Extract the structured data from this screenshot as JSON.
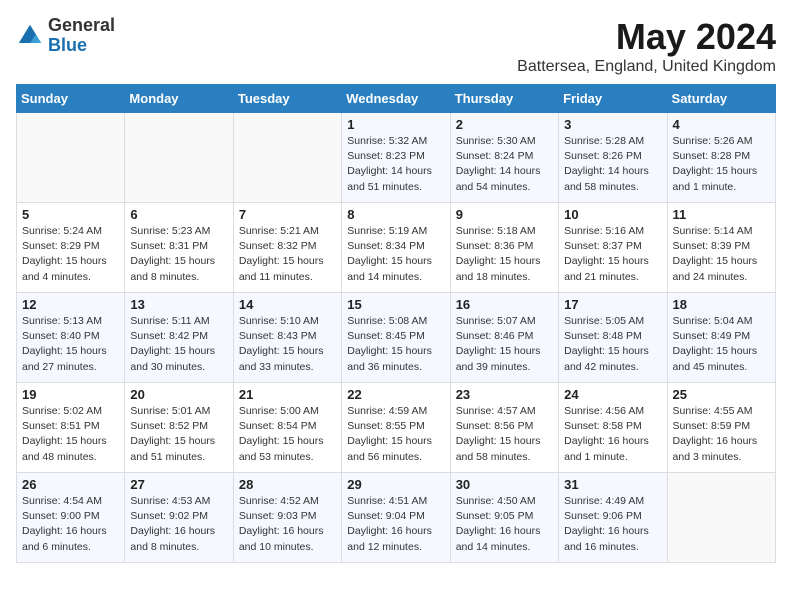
{
  "logo": {
    "general": "General",
    "blue": "Blue"
  },
  "title": "May 2024",
  "subtitle": "Battersea, England, United Kingdom",
  "days_header": [
    "Sunday",
    "Monday",
    "Tuesday",
    "Wednesday",
    "Thursday",
    "Friday",
    "Saturday"
  ],
  "weeks": [
    [
      {
        "day": "",
        "detail": ""
      },
      {
        "day": "",
        "detail": ""
      },
      {
        "day": "",
        "detail": ""
      },
      {
        "day": "1",
        "detail": "Sunrise: 5:32 AM\nSunset: 8:23 PM\nDaylight: 14 hours\nand 51 minutes."
      },
      {
        "day": "2",
        "detail": "Sunrise: 5:30 AM\nSunset: 8:24 PM\nDaylight: 14 hours\nand 54 minutes."
      },
      {
        "day": "3",
        "detail": "Sunrise: 5:28 AM\nSunset: 8:26 PM\nDaylight: 14 hours\nand 58 minutes."
      },
      {
        "day": "4",
        "detail": "Sunrise: 5:26 AM\nSunset: 8:28 PM\nDaylight: 15 hours\nand 1 minute."
      }
    ],
    [
      {
        "day": "5",
        "detail": "Sunrise: 5:24 AM\nSunset: 8:29 PM\nDaylight: 15 hours\nand 4 minutes."
      },
      {
        "day": "6",
        "detail": "Sunrise: 5:23 AM\nSunset: 8:31 PM\nDaylight: 15 hours\nand 8 minutes."
      },
      {
        "day": "7",
        "detail": "Sunrise: 5:21 AM\nSunset: 8:32 PM\nDaylight: 15 hours\nand 11 minutes."
      },
      {
        "day": "8",
        "detail": "Sunrise: 5:19 AM\nSunset: 8:34 PM\nDaylight: 15 hours\nand 14 minutes."
      },
      {
        "day": "9",
        "detail": "Sunrise: 5:18 AM\nSunset: 8:36 PM\nDaylight: 15 hours\nand 18 minutes."
      },
      {
        "day": "10",
        "detail": "Sunrise: 5:16 AM\nSunset: 8:37 PM\nDaylight: 15 hours\nand 21 minutes."
      },
      {
        "day": "11",
        "detail": "Sunrise: 5:14 AM\nSunset: 8:39 PM\nDaylight: 15 hours\nand 24 minutes."
      }
    ],
    [
      {
        "day": "12",
        "detail": "Sunrise: 5:13 AM\nSunset: 8:40 PM\nDaylight: 15 hours\nand 27 minutes."
      },
      {
        "day": "13",
        "detail": "Sunrise: 5:11 AM\nSunset: 8:42 PM\nDaylight: 15 hours\nand 30 minutes."
      },
      {
        "day": "14",
        "detail": "Sunrise: 5:10 AM\nSunset: 8:43 PM\nDaylight: 15 hours\nand 33 minutes."
      },
      {
        "day": "15",
        "detail": "Sunrise: 5:08 AM\nSunset: 8:45 PM\nDaylight: 15 hours\nand 36 minutes."
      },
      {
        "day": "16",
        "detail": "Sunrise: 5:07 AM\nSunset: 8:46 PM\nDaylight: 15 hours\nand 39 minutes."
      },
      {
        "day": "17",
        "detail": "Sunrise: 5:05 AM\nSunset: 8:48 PM\nDaylight: 15 hours\nand 42 minutes."
      },
      {
        "day": "18",
        "detail": "Sunrise: 5:04 AM\nSunset: 8:49 PM\nDaylight: 15 hours\nand 45 minutes."
      }
    ],
    [
      {
        "day": "19",
        "detail": "Sunrise: 5:02 AM\nSunset: 8:51 PM\nDaylight: 15 hours\nand 48 minutes."
      },
      {
        "day": "20",
        "detail": "Sunrise: 5:01 AM\nSunset: 8:52 PM\nDaylight: 15 hours\nand 51 minutes."
      },
      {
        "day": "21",
        "detail": "Sunrise: 5:00 AM\nSunset: 8:54 PM\nDaylight: 15 hours\nand 53 minutes."
      },
      {
        "day": "22",
        "detail": "Sunrise: 4:59 AM\nSunset: 8:55 PM\nDaylight: 15 hours\nand 56 minutes."
      },
      {
        "day": "23",
        "detail": "Sunrise: 4:57 AM\nSunset: 8:56 PM\nDaylight: 15 hours\nand 58 minutes."
      },
      {
        "day": "24",
        "detail": "Sunrise: 4:56 AM\nSunset: 8:58 PM\nDaylight: 16 hours\nand 1 minute."
      },
      {
        "day": "25",
        "detail": "Sunrise: 4:55 AM\nSunset: 8:59 PM\nDaylight: 16 hours\nand 3 minutes."
      }
    ],
    [
      {
        "day": "26",
        "detail": "Sunrise: 4:54 AM\nSunset: 9:00 PM\nDaylight: 16 hours\nand 6 minutes."
      },
      {
        "day": "27",
        "detail": "Sunrise: 4:53 AM\nSunset: 9:02 PM\nDaylight: 16 hours\nand 8 minutes."
      },
      {
        "day": "28",
        "detail": "Sunrise: 4:52 AM\nSunset: 9:03 PM\nDaylight: 16 hours\nand 10 minutes."
      },
      {
        "day": "29",
        "detail": "Sunrise: 4:51 AM\nSunset: 9:04 PM\nDaylight: 16 hours\nand 12 minutes."
      },
      {
        "day": "30",
        "detail": "Sunrise: 4:50 AM\nSunset: 9:05 PM\nDaylight: 16 hours\nand 14 minutes."
      },
      {
        "day": "31",
        "detail": "Sunrise: 4:49 AM\nSunset: 9:06 PM\nDaylight: 16 hours\nand 16 minutes."
      },
      {
        "day": "",
        "detail": ""
      }
    ]
  ]
}
